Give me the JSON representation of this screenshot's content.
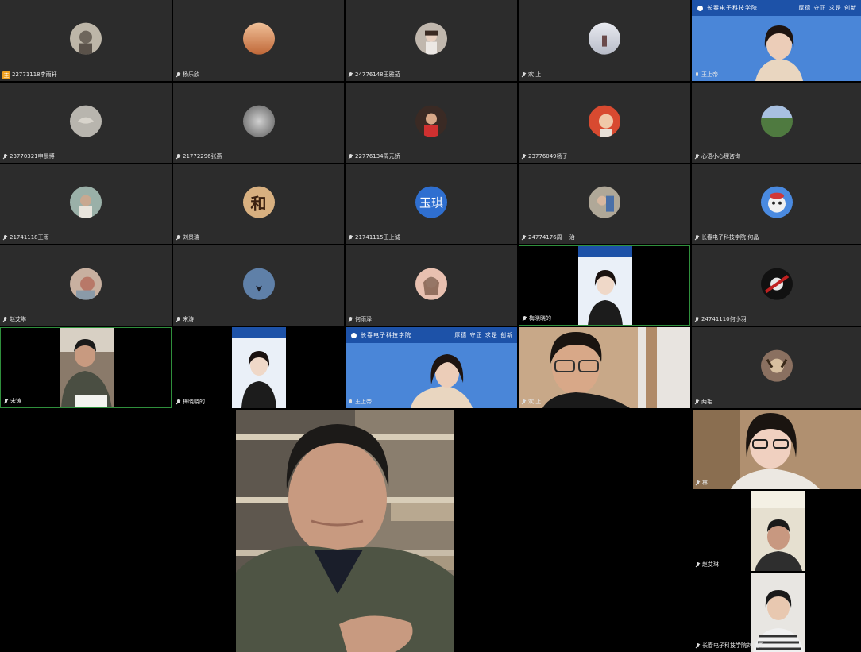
{
  "grid": {
    "tiles": [
      {
        "name": "22771118李雨轩",
        "label": "22771118李雨轩",
        "avatar": {
          "bg": "#bdb6a8"
        },
        "host": true
      },
      {
        "name": "杨乐欣",
        "label": "杨乐欣",
        "avatar": {
          "bg": "#d79668"
        }
      },
      {
        "name": "24776148王雅茹",
        "label": "24776148王雅茹",
        "avatar": {
          "bg": "#c0b7ad"
        }
      },
      {
        "name": "欢上",
        "label": "欢   上",
        "avatar": {
          "bg": "#d8d8dc"
        }
      },
      {
        "name": "王上帝-video",
        "label": "王上帝"
      },
      {
        "name": "23770321申晨博",
        "label": "23770321申晨博",
        "avatar": {
          "bg": "#b8b5ae"
        }
      },
      {
        "name": "21772296张燕",
        "label": "21772296张燕",
        "avatar": {
          "bg": "#9a9a9a"
        }
      },
      {
        "name": "22776134周元娇",
        "label": "22776134周元娇",
        "avatar": {
          "bg": "#7a4a3a"
        }
      },
      {
        "name": "23776049杨子",
        "label": "23776049杨子",
        "avatar": {
          "bg": "#d55a40"
        }
      },
      {
        "name": "心语小心理",
        "label": "心语小心理咨询",
        "avatar": {
          "bg": "#6b8f5a"
        }
      },
      {
        "name": "21741118王雨",
        "label": "21741118王雨",
        "avatar": {
          "bg": "#9a9080"
        }
      },
      {
        "name": "刘景瑞",
        "label": "刘景瑞",
        "avatar": {
          "bg": "#caa068",
          "text": "和"
        }
      },
      {
        "name": "21741115王上诚",
        "label": "21741115王上诚",
        "avatar": {
          "bg": "#2f6fd0",
          "text": "玉琪"
        }
      },
      {
        "name": "24774176周一",
        "label": "24774176周一   治",
        "avatar": {
          "bg": "#a09888"
        }
      },
      {
        "name": "长春电子科技学院-何晶",
        "label": "长春电子科技学院 何晶",
        "avatar": {
          "bg": "#3a7ad8"
        }
      },
      {
        "name": "赵艾琳",
        "label": "赵艾琳",
        "avatar": {
          "bg": "#b89080"
        }
      },
      {
        "name": "宋涛",
        "label": "宋涛",
        "avatar": {
          "bg": "#4f6f98"
        }
      },
      {
        "name": "何雨泽",
        "label": "何雨泽",
        "avatar": {
          "bg": "#caa088"
        }
      },
      {
        "name": "梅晓晓-video",
        "label": "梅晓晓的"
      },
      {
        "name": "24741110何小羽",
        "label": "24741110何小羽",
        "avatar": {
          "bg": "#aa2020"
        }
      },
      {
        "name": "宋涛-video",
        "label": "宋涛"
      },
      {
        "name": "梅晓晓2-video",
        "label": "梅晓晓的"
      },
      {
        "name": "王上帝2-video",
        "label": "王上帝"
      },
      {
        "name": "欢上-video",
        "label": "欢   上"
      },
      {
        "name": "两毛",
        "label": "两毛",
        "avatar": {
          "bg": "#9a8070"
        }
      }
    ]
  },
  "school_banner": {
    "name": "长春电子科技学院",
    "motto": "厚德 守正 求是 创新"
  },
  "speaker": {
    "label": ""
  },
  "side": {
    "top": {
      "label": "林"
    },
    "middle": {
      "label": "赵艾琳"
    },
    "bottom": {
      "label": "长春电子科技学院刘圆圆"
    }
  },
  "colors": {
    "tile_bg": "#2c2c2c",
    "active_border": "#2f8f3c",
    "banner_blue": "#1d52a8",
    "video_blue": "#4a86d8"
  }
}
